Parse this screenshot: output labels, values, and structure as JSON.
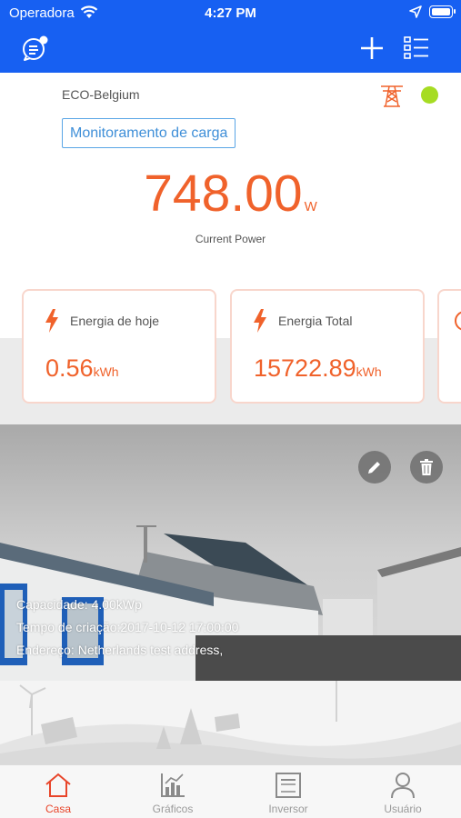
{
  "status_bar": {
    "carrier": "Operadora",
    "time": "4:27 PM"
  },
  "station": {
    "name": "ECO-Belgium",
    "status_color": "#a6dc23",
    "mode_button": "Monitoramento de carga"
  },
  "power": {
    "value": "748.00",
    "unit": "W",
    "label": "Current Power"
  },
  "cards": [
    {
      "title": "Energia de hoje",
      "value": "0.56",
      "unit": "kWh",
      "icon": "lightning-icon"
    },
    {
      "title": "Energia Total",
      "value": "15722.89",
      "unit": "kWh",
      "icon": "lightning-icon"
    }
  ],
  "plant_info": {
    "capacity": "Capacidade: 4.00kWp",
    "created": "Tempo de criação:2017-10-12 17:00:00",
    "address": "Endereço: Netherlands test address,"
  },
  "tabs": [
    {
      "label": "Casa",
      "icon": "home-icon",
      "active": true
    },
    {
      "label": "Gráficos",
      "icon": "chart-icon",
      "active": false
    },
    {
      "label": "Inversor",
      "icon": "inverter-icon",
      "active": false
    },
    {
      "label": "Usuário",
      "icon": "user-icon",
      "active": false
    }
  ],
  "colors": {
    "header": "#1760f2",
    "accent": "#f0622b",
    "tab_active": "#e8452a"
  }
}
